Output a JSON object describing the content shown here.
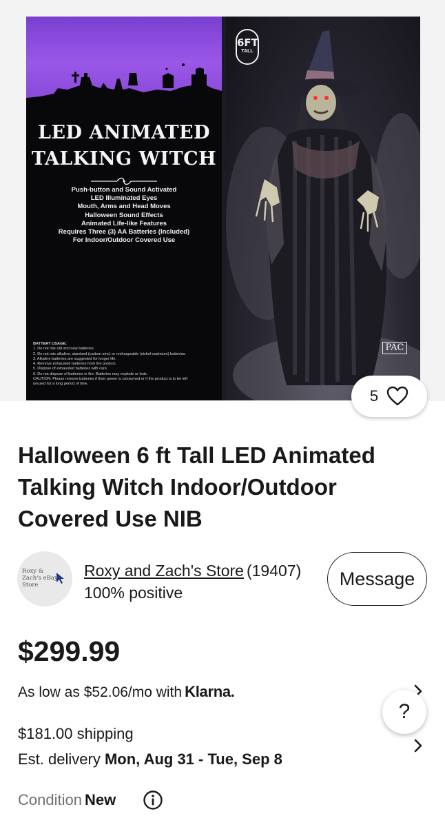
{
  "product_image": {
    "badge_big": "6FT",
    "badge_small": "TALL",
    "box_title_line1": "LED ANIMATED",
    "box_title_line2": "TALKING WITCH",
    "features": [
      "Push-button and Sound Activated",
      "LED Illuminated Eyes",
      "Mouth, Arms and Head Moves",
      "Halloween Sound Effects",
      "Animated Life-like Features",
      "Requires Three (3) AA Batteries (Included)",
      "For Indoor/Outdoor Covered Use"
    ],
    "battery_heading": "BATTERY USAGE:",
    "battery_lines": [
      "1. Do not mix old and new batteries.",
      "2. Do not mix alkaline, standard (carbon-zinc) or rechargeable (nickel-cadmium) batteries.",
      "3. Alkaline batteries are suggested for longer life.",
      "4. Remove exhausted batteries from the product.",
      "5. Dispose of exhausted batteries with care.",
      "6. Do not dispose of batteries in fire. Batteries may explode or leak.",
      "CAUTION: Please remove batteries if their power is consumed or if the product is to be left",
      "unused for a long period of time."
    ],
    "brand_logo": "PAC"
  },
  "watch": {
    "count": "5",
    "icon": "heart-icon"
  },
  "listing": {
    "title": "Halloween 6 ft Tall LED Animated Talking Witch Indoor/Outdoor Covered Use NIB"
  },
  "seller": {
    "avatar_text": "Roxy & Zach's eBay Store",
    "store_name": "Roxy and Zach's Store",
    "feedback_count": "(19407)",
    "positive": "100% positive",
    "message_label": "Message"
  },
  "pricing": {
    "price": "$299.99",
    "installment_text": "As low as $52.06/mo with",
    "klarna_label": "Klarna.",
    "shipping": "$181.00 shipping",
    "delivery_prefix": "Est. delivery",
    "delivery_dates": "Mon, Aug 31 - Tue, Sep 8"
  },
  "condition": {
    "label": "Condition",
    "value": "New",
    "icon": "info-icon"
  },
  "help": {
    "label": "?"
  },
  "colors": {
    "text": "#191919",
    "muted": "#707070",
    "box_purple": "#9a57e8"
  }
}
